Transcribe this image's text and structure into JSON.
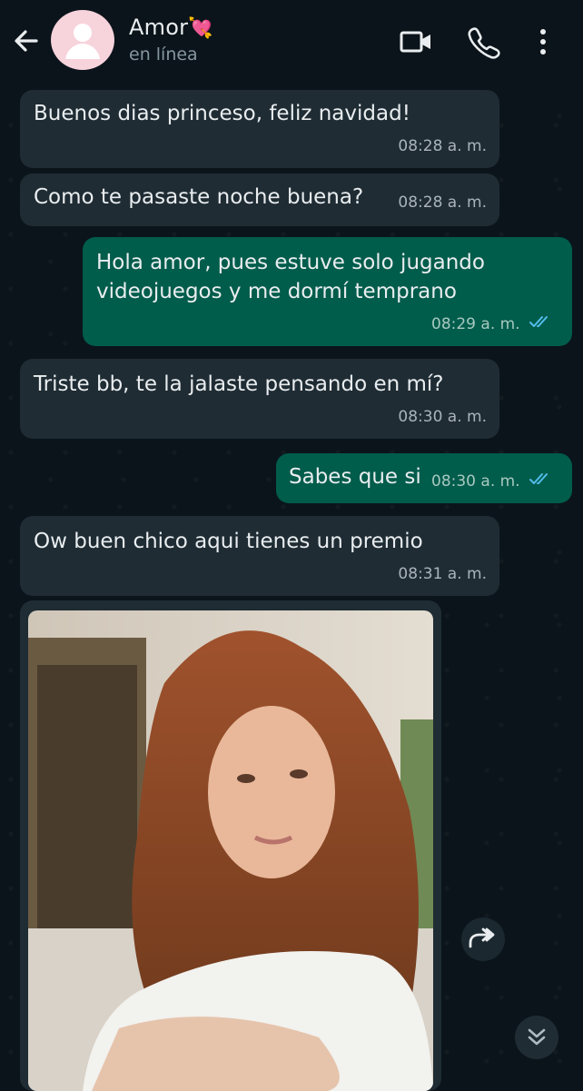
{
  "header": {
    "contact_name": "Amor",
    "contact_emoji": "💘",
    "status": "en línea",
    "back_icon": "arrow-left-icon",
    "video_icon": "video-call-icon",
    "call_icon": "phone-icon",
    "menu_icon": "more-vert-icon"
  },
  "messages": [
    {
      "direction": "in",
      "text": "Buenos dias princeso, feliz navidad!",
      "time": "08:28 a. m."
    },
    {
      "direction": "in",
      "text": "Como te pasaste noche buena?",
      "time": "08:28 a. m."
    },
    {
      "direction": "out",
      "text": "Hola amor, pues estuve solo jugando videojuegos y me dormí temprano",
      "time": "08:29 a. m.",
      "status": "read"
    },
    {
      "direction": "in",
      "text": "Triste bb, te la jalaste pensando en mí?",
      "time": "08:30 a. m."
    },
    {
      "direction": "out",
      "text": "Sabes que si",
      "time": "08:30 a. m.",
      "status": "read"
    },
    {
      "direction": "in",
      "text": "Ow buen chico aqui tienes un premio",
      "time": "08:31 a. m."
    },
    {
      "direction": "in",
      "type": "image",
      "image": "photo-of-woman-with-long-red-hair"
    }
  ],
  "colors": {
    "background": "#0b141a",
    "incoming_bubble": "#1f2c34",
    "outgoing_bubble": "#005c4b",
    "read_ticks": "#53bdeb",
    "secondary_text": "#8696a0"
  }
}
